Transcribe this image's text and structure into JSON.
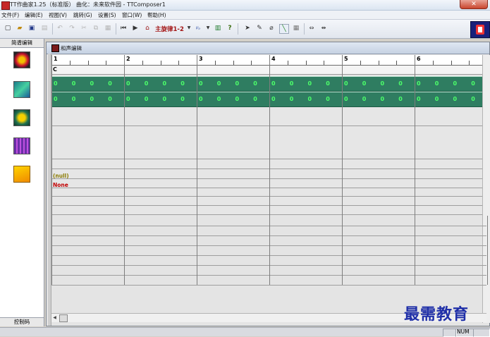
{
  "window": {
    "title": "TT作曲家1.25（标准版） 曲化：未来软件园 - TTComposer1",
    "close_label": "✕"
  },
  "menu": [
    "文件(F)",
    "编辑(E)",
    "视图(V)",
    "跳转(G)",
    "设置(S)",
    "窗口(W)",
    "帮助(H)"
  ],
  "toolbar": {
    "main_melody_label": "主旋律1-2",
    "icons": [
      "new-icon",
      "open-icon",
      "save-icon",
      "print-icon",
      "undo-icon",
      "redo-icon",
      "cut-icon",
      "copy-icon",
      "paste-icon",
      "goto-start-icon",
      "play-icon",
      "bank-icon",
      "dropdown-icon",
      "chord-icon",
      "dropdown-icon",
      "levels-icon",
      "help-icon",
      "select-arrow-icon",
      "pencil-icon",
      "eraser-icon",
      "line-icon",
      "grid-icon",
      "expand-icon",
      "shrink-icon"
    ]
  },
  "left_panel": {
    "header": "简谱编辑",
    "footer": "控制码",
    "icons": [
      "record-icon",
      "score-icon",
      "instrument-icon",
      "equalizer-icon",
      "music-sheet-icon"
    ]
  },
  "editor": {
    "title": "和声编辑",
    "bars": [
      "1",
      "2",
      "3",
      "4",
      "5",
      "6"
    ],
    "chord_first": "C",
    "zero_value": "0",
    "null_label": "(null)",
    "none_label": "None"
  },
  "status": {
    "num": "NUM"
  },
  "watermark": "最需教育",
  "colors": {
    "track": "#2f7d61",
    "zero_text": "#4cff6a",
    "none_text": "#c00000",
    "null_text": "#8a7a00"
  }
}
